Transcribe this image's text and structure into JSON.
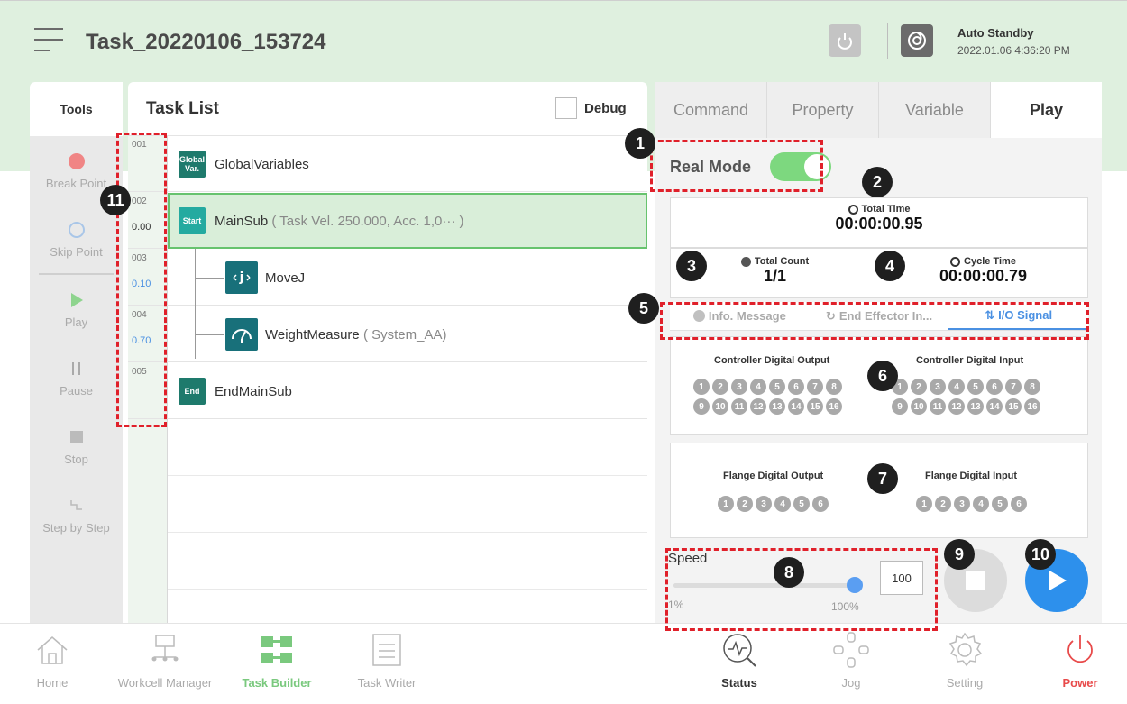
{
  "header": {
    "title": "Task_20220106_153724",
    "status": "Auto Standby",
    "timestamp": "2022.01.06 4:36:20 PM"
  },
  "tools": {
    "title": "Tools",
    "items": [
      {
        "label": "Break Point",
        "icon": "break-point-icon"
      },
      {
        "label": "Skip Point",
        "icon": "skip-point-icon"
      },
      {
        "label": "Play",
        "icon": "play-icon"
      },
      {
        "label": "Pause",
        "icon": "pause-icon"
      },
      {
        "label": "Stop",
        "icon": "stop-icon"
      },
      {
        "label": "Step by Step",
        "icon": "step-icon"
      }
    ]
  },
  "task_list": {
    "title": "Task List",
    "debug_label": "Debug",
    "rows": [
      {
        "num": "001",
        "val": "",
        "badge": "Global Var.",
        "label": "GlobalVariables",
        "sub": ""
      },
      {
        "num": "002",
        "val": "0.00",
        "badge": "Start",
        "label": "MainSub",
        "sub": "( Task Vel. 250.000, Acc. 1,0··· )"
      },
      {
        "num": "003",
        "val": "0.10",
        "badge": "",
        "label": "MoveJ",
        "sub": ""
      },
      {
        "num": "004",
        "val": "0.70",
        "badge": "",
        "label": "WeightMeasure",
        "sub": "( System_AA)"
      },
      {
        "num": "005",
        "val": "",
        "badge": "End",
        "label": "EndMainSub",
        "sub": ""
      }
    ]
  },
  "right_panel": {
    "tabs": [
      "Command",
      "Property",
      "Variable",
      "Play"
    ],
    "active_tab": "Play",
    "real_mode_label": "Real Mode",
    "real_mode_on": true,
    "total_time_label": "Total Time",
    "total_time": "00:00:00.95",
    "total_count_label": "Total Count",
    "total_count": "1/1",
    "cycle_time_label": "Cycle Time",
    "cycle_time": "00:00:00.79",
    "io_tabs": [
      "Info. Message",
      "End Effector In...",
      "I/O Signal"
    ],
    "io_active": "I/O Signal",
    "controller_output_label": "Controller Digital Output",
    "controller_input_label": "Controller Digital Input",
    "flange_output_label": "Flange Digital Output",
    "flange_input_label": "Flange Digital Input",
    "controller_pins_row1": [
      "1",
      "2",
      "3",
      "4",
      "5",
      "6",
      "7",
      "8"
    ],
    "controller_pins_row2": [
      "9",
      "10",
      "11",
      "12",
      "13",
      "14",
      "15",
      "16"
    ],
    "flange_pins": [
      "1",
      "2",
      "3",
      "4",
      "5",
      "6"
    ],
    "speed_label": "Speed",
    "speed_value": "100",
    "speed_min": "1%",
    "speed_max": "100%",
    "speed_fraction": 1.0
  },
  "bottom_nav": [
    {
      "label": "Home",
      "icon": "home-icon"
    },
    {
      "label": "Workcell Manager",
      "icon": "workcell-icon"
    },
    {
      "label": "Task Builder",
      "icon": "task-builder-icon"
    },
    {
      "label": "Task Writer",
      "icon": "task-writer-icon"
    },
    {
      "label": "Status",
      "icon": "status-icon"
    },
    {
      "label": "Jog",
      "icon": "jog-icon"
    },
    {
      "label": "Setting",
      "icon": "gear-icon"
    },
    {
      "label": "Power",
      "icon": "power-icon"
    }
  ],
  "callouts": [
    "1",
    "2",
    "3",
    "4",
    "5",
    "6",
    "7",
    "8",
    "9",
    "10",
    "11"
  ],
  "colors": {
    "header_bg": "#dff0df",
    "accent_green": "#7ac97e",
    "accent_blue": "#2d90ec",
    "power_red": "#e84a4a",
    "annotation_red": "#e0202a"
  }
}
